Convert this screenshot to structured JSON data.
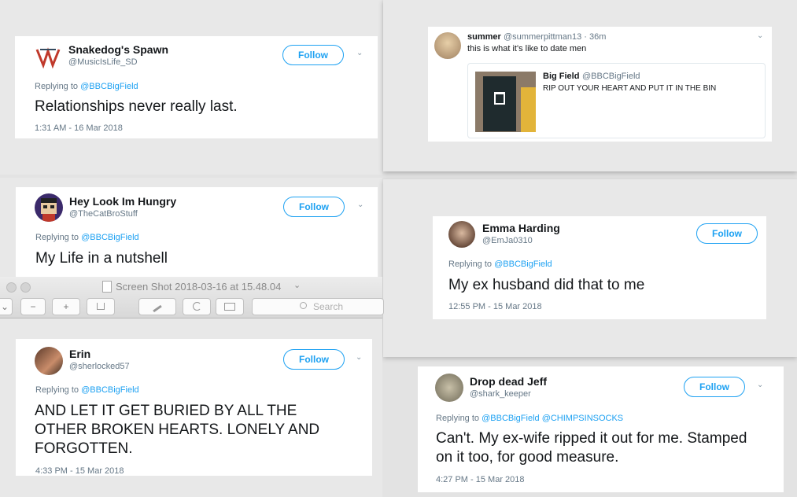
{
  "tweets": [
    {
      "name": "Snakedog's Spawn",
      "handle": "@MusicIsLife_SD",
      "reply_prefix": "Replying to",
      "reply_to": "@BBCBigField",
      "text": "Relationships never really last.",
      "time": "1:31 AM - 16 Mar 2018",
      "follow": "Follow"
    },
    {
      "name": "Hey Look Im Hungry",
      "handle": "@TheCatBroStuff",
      "reply_prefix": "Replying to",
      "reply_to": "@BBCBigField",
      "text": "My Life in a nutshell",
      "follow": "Follow"
    },
    {
      "name": "Erin",
      "handle": "@sherlocked57",
      "reply_prefix": "Replying to",
      "reply_to": "@BBCBigField",
      "text": "AND LET IT GET BURIED BY ALL THE OTHER BROKEN HEARTS. LONELY AND FORGOTTEN.",
      "time": "4:33 PM - 15 Mar 2018",
      "follow": "Follow"
    },
    {
      "name": "Emma Harding",
      "handle": "@EmJa0310",
      "reply_prefix": "Replying to",
      "reply_to": "@BBCBigField",
      "text": "My ex husband did that to me",
      "time": "12:55 PM - 15 Mar 2018",
      "follow": "Follow"
    },
    {
      "name": "Drop dead Jeff",
      "handle": "@shark_keeper",
      "reply_prefix": "Replying to",
      "reply_to": "@BBCBigField @CHIMPSINSOCKS",
      "text": "Can't. My ex-wife ripped it out for me. Stamped on it too, for good measure.",
      "time": "4:27 PM - 15 Mar 2018",
      "follow": "Follow"
    }
  ],
  "summer": {
    "name": "summer",
    "handle": "@summerpittman13 · 36m",
    "text": "this is what it's like to date men",
    "quote": {
      "name": "Big Field",
      "handle": "@BBCBigField",
      "text": "RIP OUT YOUR HEART AND PUT IT IN THE BIN"
    }
  },
  "preview": {
    "title": "Screen Shot 2018-03-16 at 15.48.04",
    "title_chevron": "⌄",
    "search_placeholder": "Search"
  },
  "icons": {
    "chevron": "⌄",
    "zoom_out": "−",
    "zoom_in": "+"
  },
  "colors": {
    "accent": "#1da1f2"
  }
}
